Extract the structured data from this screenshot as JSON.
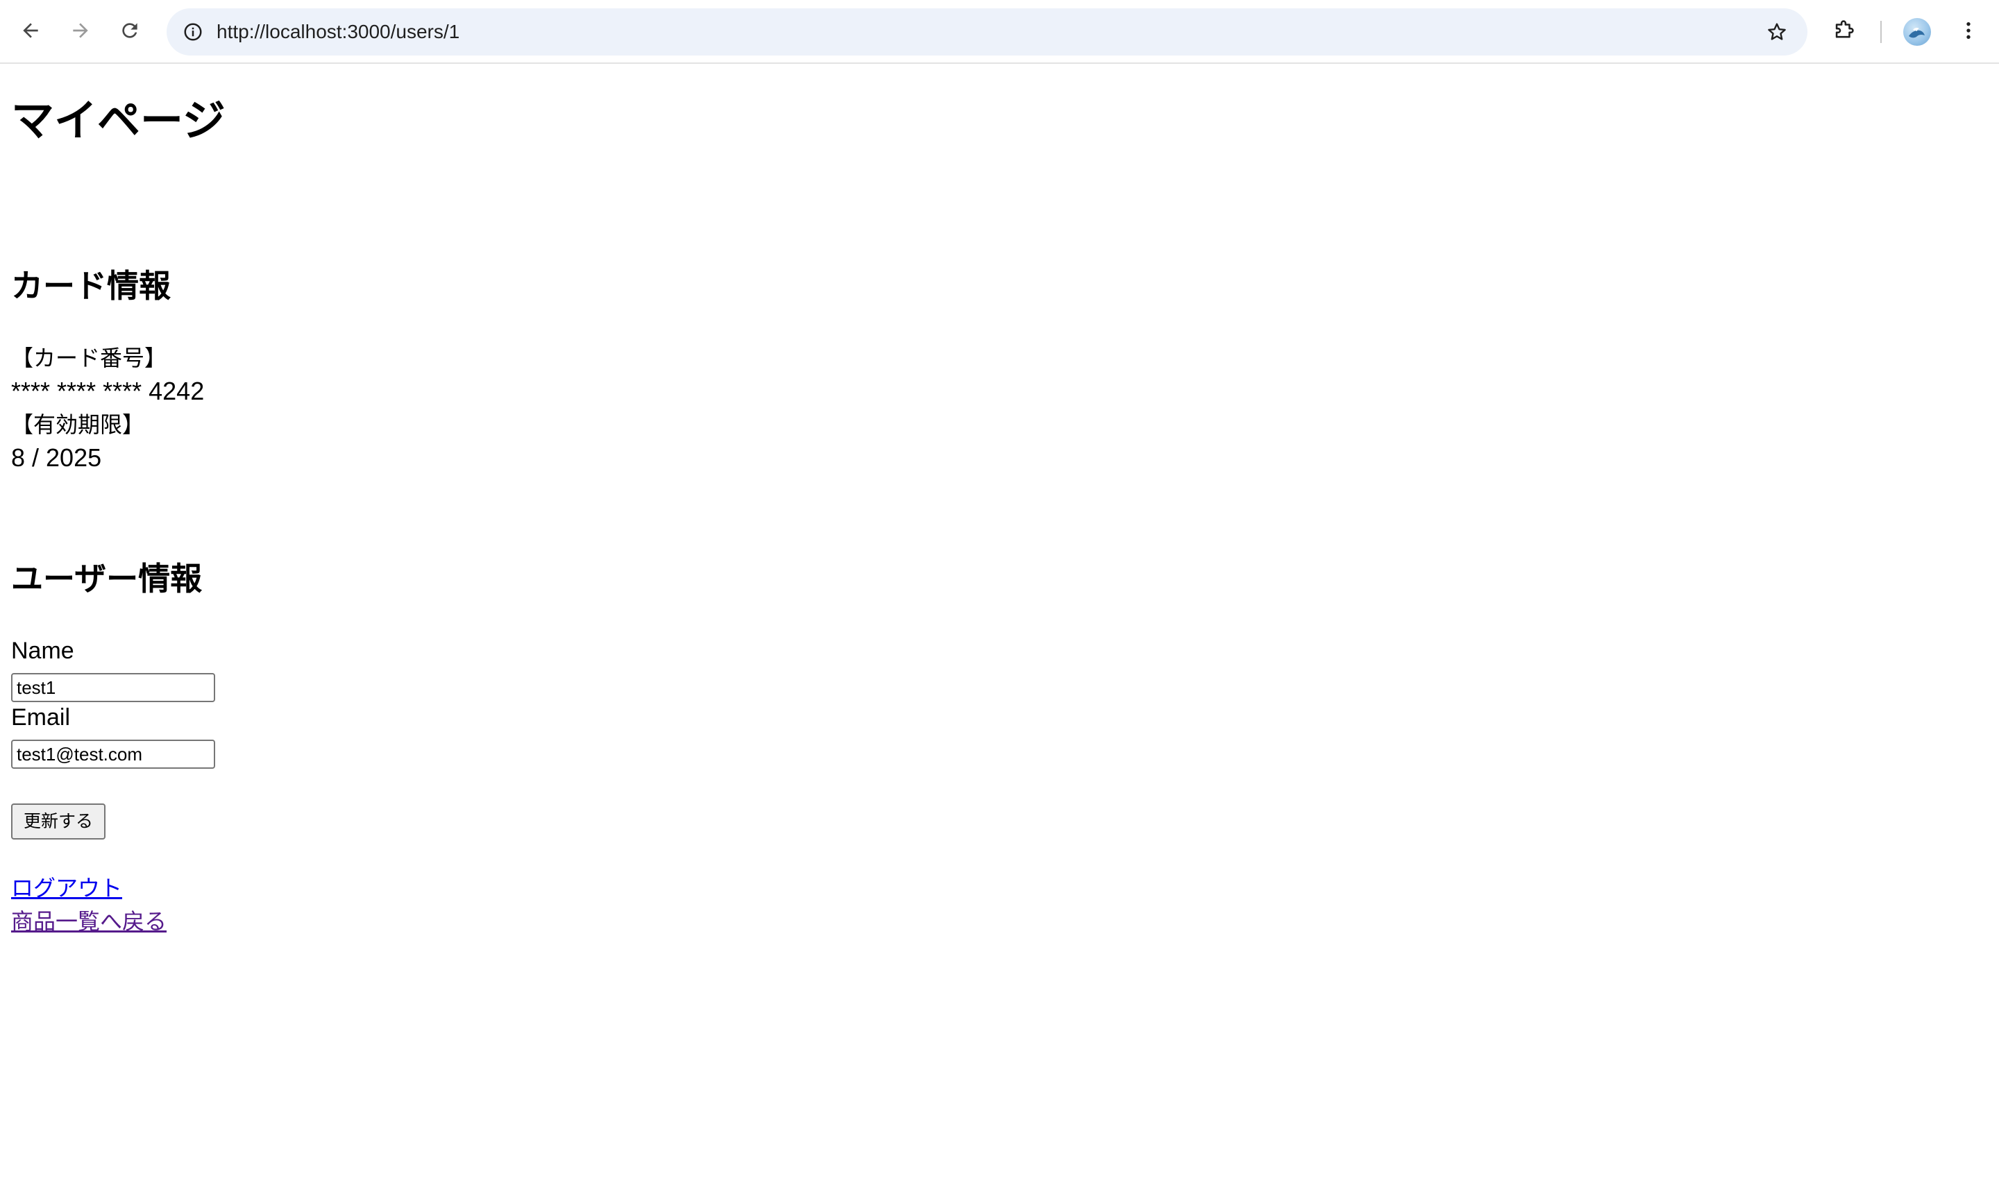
{
  "browser": {
    "url": "http://localhost:3000/users/1"
  },
  "page": {
    "title": "マイページ",
    "card_section": {
      "heading": "カード情報",
      "number_label": "【カード番号】",
      "number_value": "**** **** **** 4242",
      "expiry_label": "【有効期限】",
      "expiry_value": "8 / 2025"
    },
    "user_section": {
      "heading": "ユーザー情報",
      "name_label": "Name",
      "name_value": "test1",
      "email_label": "Email",
      "email_value": "test1@test.com",
      "submit_label": "更新する"
    },
    "links": {
      "logout": "ログアウト",
      "back_to_products": "商品一覧へ戻る"
    }
  },
  "colors": {
    "link_unvisited": "#0000ee",
    "link_visited": "#551a8b",
    "omnibox_bg": "#edf2fa"
  }
}
